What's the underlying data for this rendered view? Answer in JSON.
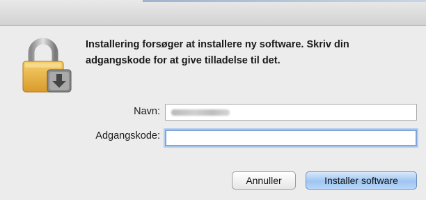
{
  "dialog": {
    "message": "Installering forsøger at installere ny software. Skriv din adgangskode for at give tilladelse til det."
  },
  "form": {
    "name_label": "Navn:",
    "password_label": "Adgangskode:",
    "name_value": "",
    "password_value": ""
  },
  "buttons": {
    "cancel_label": "Annuller",
    "install_label": "Installer software"
  },
  "icons": {
    "dialog_icon": "lock-icon"
  },
  "colors": {
    "default_button": "#9ec5f2",
    "focus_ring": "#7fa6d8"
  }
}
